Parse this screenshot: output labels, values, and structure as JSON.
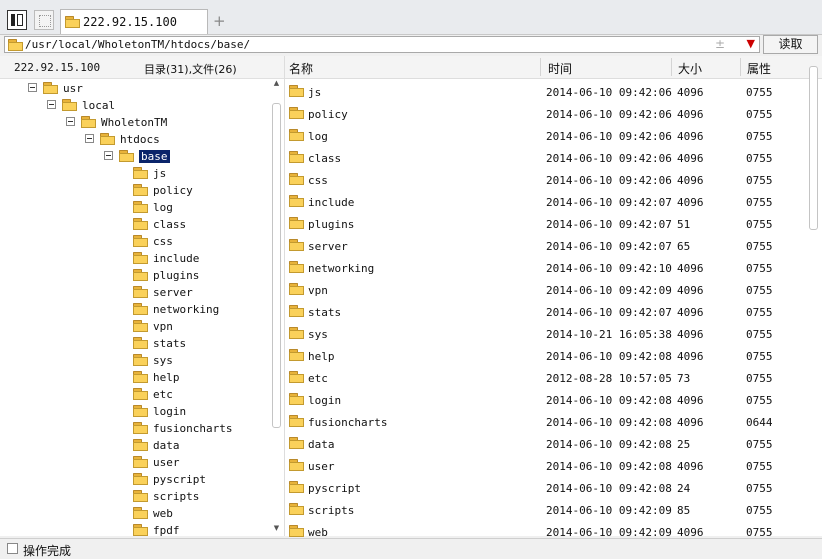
{
  "tab": {
    "label": "222.92.15.100",
    "new_tab": "+"
  },
  "address": {
    "path": "/usr/local/WholetonTM/htdocs/base/",
    "plus_minus": "±",
    "dropdown": "▼",
    "read_button": "读取"
  },
  "left_panel": {
    "host": "222.92.15.100",
    "counts": "目录(31),文件(26)",
    "tree": [
      {
        "name": "usr",
        "depth": 0,
        "expand": true
      },
      {
        "name": "local",
        "depth": 1,
        "expand": true
      },
      {
        "name": "WholetonTM",
        "depth": 2,
        "expand": true
      },
      {
        "name": "htdocs",
        "depth": 3,
        "expand": true
      },
      {
        "name": "base",
        "depth": 4,
        "expand": true,
        "selected": true
      },
      {
        "name": "js",
        "depth": 5
      },
      {
        "name": "policy",
        "depth": 5
      },
      {
        "name": "log",
        "depth": 5
      },
      {
        "name": "class",
        "depth": 5
      },
      {
        "name": "css",
        "depth": 5
      },
      {
        "name": "include",
        "depth": 5
      },
      {
        "name": "plugins",
        "depth": 5
      },
      {
        "name": "server",
        "depth": 5
      },
      {
        "name": "networking",
        "depth": 5
      },
      {
        "name": "vpn",
        "depth": 5
      },
      {
        "name": "stats",
        "depth": 5
      },
      {
        "name": "sys",
        "depth": 5
      },
      {
        "name": "help",
        "depth": 5
      },
      {
        "name": "etc",
        "depth": 5
      },
      {
        "name": "login",
        "depth": 5
      },
      {
        "name": "fusioncharts",
        "depth": 5
      },
      {
        "name": "data",
        "depth": 5
      },
      {
        "name": "user",
        "depth": 5
      },
      {
        "name": "pyscript",
        "depth": 5
      },
      {
        "name": "scripts",
        "depth": 5
      },
      {
        "name": "web",
        "depth": 5
      },
      {
        "name": "fpdf",
        "depth": 5
      }
    ],
    "scroll_up": "▲",
    "scroll_down": "▼"
  },
  "file_list": {
    "columns": {
      "name": "名称",
      "time": "时间",
      "size": "大小",
      "attr": "属性"
    },
    "rows": [
      {
        "name": "js",
        "time": "2014-06-10 09:42:06",
        "size": "4096",
        "attr": "0755"
      },
      {
        "name": "policy",
        "time": "2014-06-10 09:42:06",
        "size": "4096",
        "attr": "0755"
      },
      {
        "name": "log",
        "time": "2014-06-10 09:42:06",
        "size": "4096",
        "attr": "0755"
      },
      {
        "name": "class",
        "time": "2014-06-10 09:42:06",
        "size": "4096",
        "attr": "0755"
      },
      {
        "name": "css",
        "time": "2014-06-10 09:42:06",
        "size": "4096",
        "attr": "0755"
      },
      {
        "name": "include",
        "time": "2014-06-10 09:42:07",
        "size": "4096",
        "attr": "0755"
      },
      {
        "name": "plugins",
        "time": "2014-06-10 09:42:07",
        "size": "51",
        "attr": "0755"
      },
      {
        "name": "server",
        "time": "2014-06-10 09:42:07",
        "size": "65",
        "attr": "0755"
      },
      {
        "name": "networking",
        "time": "2014-06-10 09:42:10",
        "size": "4096",
        "attr": "0755"
      },
      {
        "name": "vpn",
        "time": "2014-06-10 09:42:09",
        "size": "4096",
        "attr": "0755"
      },
      {
        "name": "stats",
        "time": "2014-06-10 09:42:07",
        "size": "4096",
        "attr": "0755"
      },
      {
        "name": "sys",
        "time": "2014-10-21 16:05:38",
        "size": "4096",
        "attr": "0755"
      },
      {
        "name": "help",
        "time": "2014-06-10 09:42:08",
        "size": "4096",
        "attr": "0755"
      },
      {
        "name": "etc",
        "time": "2012-08-28 10:57:05",
        "size": "73",
        "attr": "0755"
      },
      {
        "name": "login",
        "time": "2014-06-10 09:42:08",
        "size": "4096",
        "attr": "0755"
      },
      {
        "name": "fusioncharts",
        "time": "2014-06-10 09:42:08",
        "size": "4096",
        "attr": "0644"
      },
      {
        "name": "data",
        "time": "2014-06-10 09:42:08",
        "size": "25",
        "attr": "0755"
      },
      {
        "name": "user",
        "time": "2014-06-10 09:42:08",
        "size": "4096",
        "attr": "0755"
      },
      {
        "name": "pyscript",
        "time": "2014-06-10 09:42:08",
        "size": "24",
        "attr": "0755"
      },
      {
        "name": "scripts",
        "time": "2014-06-10 09:42:09",
        "size": "85",
        "attr": "0755"
      },
      {
        "name": "web",
        "time": "2014-06-10 09:42:09",
        "size": "4096",
        "attr": "0755"
      }
    ]
  },
  "status": {
    "text": "操作完成"
  }
}
